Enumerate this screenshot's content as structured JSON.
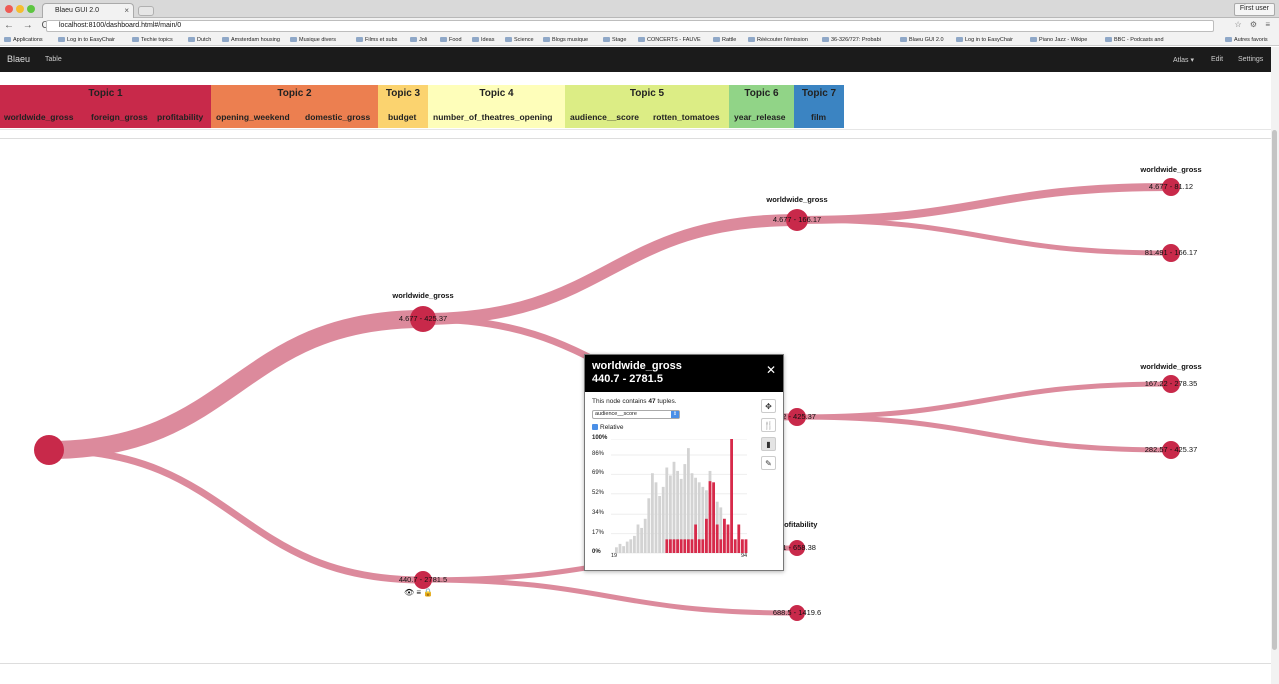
{
  "browser": {
    "tab_title": "Blaeu GUI 2.0",
    "tab_close": "×",
    "first_user": "First user",
    "url": "localhost:8100/dashboard.html#/main/0",
    "nav_glyphs": "← → C",
    "ext_glyphs": "☆ ⚙ ≡",
    "bookmarks": [
      "Applications",
      "Log in to EasyChair",
      "Techie topics",
      "Dutch",
      "Amsterdam housing",
      "Musique divers",
      "Films et subs",
      "Joli",
      "Food",
      "Ideas",
      "Science",
      "Blogs musique",
      "Stage",
      "CONCERTS - FAUVE",
      "Rattle",
      "Réécouter l'émission",
      "36-326/727: Probabi",
      "Blaeu GUI 2.0",
      "Log in to EasyChair",
      "Piano Jazz - Wikipe",
      "BBC - Podcasts and",
      "Autres favoris"
    ]
  },
  "app": {
    "brand": "Blaeu",
    "nav_table": "Table",
    "nav_atlas": "Atlas ▾",
    "nav_edit": "Edit",
    "nav_settings": "Settings"
  },
  "topics": [
    {
      "title": "Topic 1",
      "color": "#c8294a",
      "items": [
        "worldwide_gross",
        "foreign_gross",
        "profitability"
      ]
    },
    {
      "title": "Topic 2",
      "color": "#ec7f50",
      "items": [
        "opening_weekend",
        "domestic_gross"
      ]
    },
    {
      "title": "Topic 3",
      "color": "#fbd36f",
      "items": [
        "budget"
      ]
    },
    {
      "title": "Topic 4",
      "color": "#fefeba",
      "items": [
        "number_of_theatres_opening"
      ]
    },
    {
      "title": "Topic 5",
      "color": "#dced85",
      "items": [
        "audience__score",
        "rotten_tomatoes"
      ]
    },
    {
      "title": "Topic 6",
      "color": "#91d487",
      "items": [
        "year_release"
      ]
    },
    {
      "title": "Topic 7",
      "color": "#3b84c2",
      "items": [
        "film"
      ]
    }
  ],
  "tree": {
    "edge_color": "#dc8a9c",
    "node_color": "#c8294a",
    "nodes": [
      {
        "label": "worldwide_gross",
        "range": "4.677 - 425.37"
      },
      {
        "label": "",
        "range": "440.7 - 2781.5"
      },
      {
        "label": "worldwide_gross",
        "range": "4.677 - 166.17"
      },
      {
        "label": "",
        "range": "22 - 425.37"
      },
      {
        "label": "profitability",
        "range": "61 - 658.38"
      },
      {
        "label": "",
        "range": "688.5 - 1419.6"
      },
      {
        "label": "worldwide_gross",
        "range": "4.677 - 81.12"
      },
      {
        "label": "",
        "range": "81.491 - 166.17"
      },
      {
        "label": "worldwide_gross",
        "range": "167.22 - 278.35"
      },
      {
        "label": "",
        "range": "282.57 - 425.37"
      }
    ],
    "node_icons": "👁 ≡ 🔒"
  },
  "popup": {
    "title": "worldwide_gross",
    "range": "440.7 - 2781.5",
    "desc_prefix": "This node contains ",
    "tuples": "47",
    "desc_suffix": " tuples.",
    "select_value": "audience__score",
    "select_arrow": "⇕",
    "relative_label": "Relative",
    "close": "✕",
    "tools": [
      "✥",
      "🍴",
      "▮",
      "✎"
    ],
    "chart_data": {
      "type": "bar",
      "title": "",
      "x_range": [
        19,
        94
      ],
      "x_tick_labels": [
        "19",
        "94"
      ],
      "y_tick_labels": [
        "0%",
        "17%",
        "34%",
        "52%",
        "69%",
        "86%",
        "100%"
      ],
      "ylim": [
        0,
        100
      ],
      "series": [
        {
          "color": "#d3d3d3",
          "values": [
            5,
            8,
            6,
            10,
            12,
            15,
            25,
            22,
            30,
            48,
            70,
            62,
            50,
            58,
            75,
            68,
            80,
            72,
            65,
            78,
            92,
            70,
            66,
            62,
            58,
            55,
            72,
            60,
            45,
            40,
            30,
            25,
            18,
            12,
            10
          ]
        },
        {
          "color": "#d72a4a",
          "values": [
            0,
            0,
            0,
            0,
            0,
            0,
            0,
            0,
            0,
            0,
            0,
            0,
            0,
            0,
            12,
            12,
            12,
            12,
            12,
            12,
            12,
            12,
            25,
            12,
            12,
            30,
            63,
            62,
            25,
            12,
            30,
            25,
            100,
            12,
            25,
            12,
            12
          ]
        }
      ]
    }
  }
}
